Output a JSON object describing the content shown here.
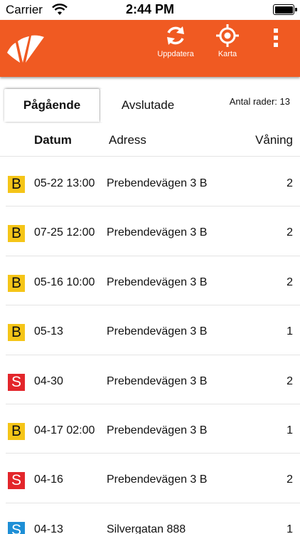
{
  "status_bar": {
    "carrier": "Carrier",
    "time": "2:44 PM",
    "wifi_icon": "wifi-icon",
    "battery_icon": "battery-icon"
  },
  "header": {
    "background_color": "#f05a22",
    "logo_icon": "brand-logo-icon",
    "refresh_label": "Uppdatera",
    "refresh_icon": "refresh-icon",
    "map_label": "Karta",
    "map_icon": "location-target-icon",
    "more_icon": "more-vertical-icon"
  },
  "tabs": {
    "active_label": "Pågående",
    "inactive_label": "Avslutade",
    "row_count": "Antal rader: 13"
  },
  "columns": {
    "date": "Datum",
    "address": "Adress",
    "floor": "Våning"
  },
  "rows": [
    {
      "badge": "B",
      "badge_style": "B",
      "date": "05-22 13:00",
      "address": "Prebendevägen 3 B",
      "floor": "2"
    },
    {
      "badge": "B",
      "badge_style": "B",
      "date": "07-25 12:00",
      "address": "Prebendevägen 3 B",
      "floor": "2"
    },
    {
      "badge": "B",
      "badge_style": "B",
      "date": "05-16 10:00",
      "address": "Prebendevägen 3 B",
      "floor": "2"
    },
    {
      "badge": "B",
      "badge_style": "B",
      "date": "05-13",
      "address": "Prebendevägen 3 B",
      "floor": "1"
    },
    {
      "badge": "S",
      "badge_style": "S-red",
      "date": "04-30",
      "address": "Prebendevägen 3 B",
      "floor": "2"
    },
    {
      "badge": "B",
      "badge_style": "B",
      "date": "04-17 02:00",
      "address": "Prebendevägen 3 B",
      "floor": "1"
    },
    {
      "badge": "S",
      "badge_style": "S-red",
      "date": "04-16",
      "address": "Prebendevägen 3 B",
      "floor": "2"
    },
    {
      "badge": "S",
      "badge_style": "S-blue",
      "date": "04-13",
      "address": "Silvergatan 888",
      "floor": "1"
    }
  ],
  "colors": {
    "badge_B": "#f5c518",
    "badge_S_red": "#e3262b",
    "badge_S_blue": "#1e8fd6"
  }
}
